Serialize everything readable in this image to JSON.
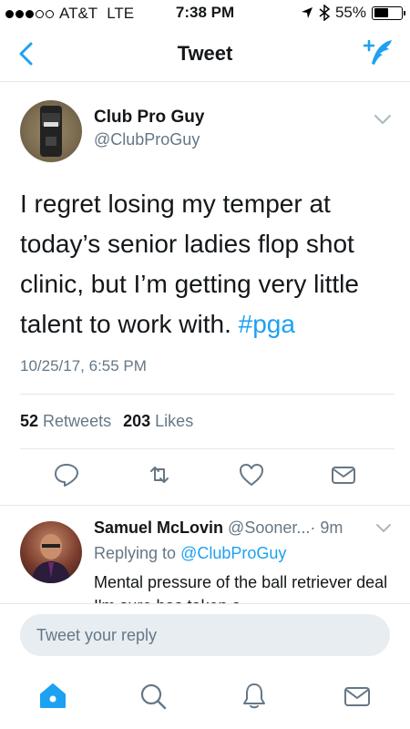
{
  "status_bar": {
    "carrier": "AT&T",
    "network": "LTE",
    "time": "7:38 PM",
    "battery_text": "55%",
    "battery_level": 0.55,
    "signal_bars": 3
  },
  "nav": {
    "title": "Tweet"
  },
  "tweet": {
    "author_name": "Club Pro Guy",
    "author_handle": "@ClubProGuy",
    "text": "I regret losing my temper at today’s senior ladies flop shot clinic, but I’m getting very little talent to work with.",
    "hashtag": "#pga",
    "timestamp": "10/25/17, 6:55 PM",
    "retweets_count": "52",
    "retweets_label": "Retweets",
    "likes_count": "203",
    "likes_label": "Likes"
  },
  "reply": {
    "author_name": "Samuel McLovin",
    "author_handle": "@Sooner...",
    "age": "· 9m",
    "replying_prefix": "Replying to",
    "replying_to": "@ClubProGuy",
    "text": "Mental pressure of the ball retriever deal I'm sure has taken a"
  },
  "composer": {
    "placeholder": "Tweet your reply"
  },
  "colors": {
    "accent": "#1da1f2",
    "secondary_text": "#657786",
    "divider": "#e1e8ed"
  },
  "icons": {
    "back": "chevron-left-icon",
    "compose": "compose-tweet-icon",
    "more": "chevron-down-icon",
    "reply": "reply-icon",
    "retweet": "retweet-icon",
    "like": "heart-icon",
    "dm": "envelope-icon",
    "tabs": [
      "home-icon",
      "search-icon",
      "notifications-icon",
      "messages-icon"
    ]
  }
}
